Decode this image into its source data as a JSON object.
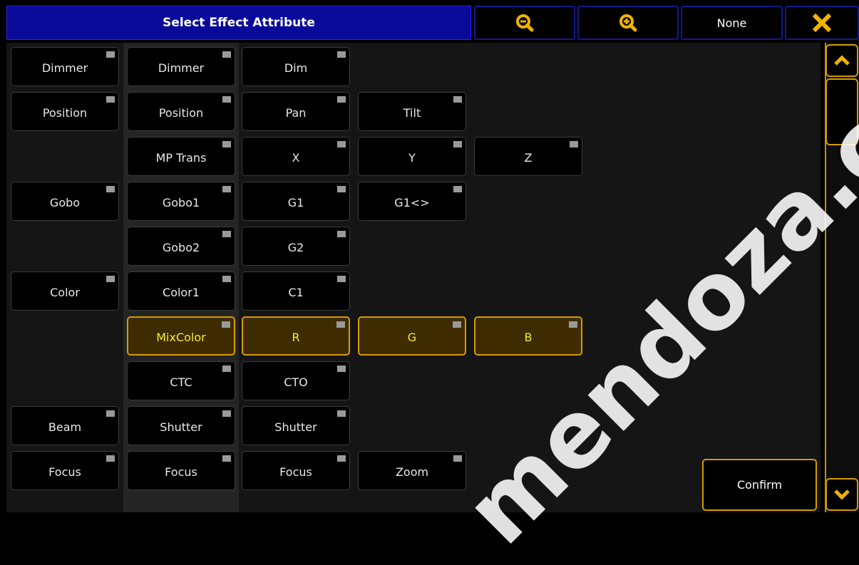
{
  "header": {
    "title": "Select Effect Attribute",
    "none_label": "None"
  },
  "icons": {
    "zoom_out": "zoom-out-icon",
    "zoom_in": "zoom-in-icon",
    "close": "close-icon",
    "scroll_up": "chevron-up-icon",
    "scroll_down": "chevron-down-icon"
  },
  "colors": {
    "accent": "#d49a00",
    "selected_text": "#f2ef2c",
    "title_bg": "#0a0a9a"
  },
  "rows": [
    [
      "Dimmer",
      "Dimmer",
      "Dim",
      "",
      ""
    ],
    [
      "Position",
      "Position",
      "Pan",
      "Tilt",
      ""
    ],
    [
      "",
      "MP Trans",
      "X",
      "Y",
      "Z"
    ],
    [
      "Gobo",
      "Gobo1",
      "G1",
      "G1<>",
      ""
    ],
    [
      "",
      "Gobo2",
      "G2",
      "",
      ""
    ],
    [
      "Color",
      "Color1",
      "C1",
      "",
      ""
    ],
    [
      "",
      "MixColor",
      "R",
      "G",
      "B"
    ],
    [
      "",
      "CTC",
      "CTO",
      "",
      ""
    ],
    [
      "Beam",
      "Shutter",
      "Shutter",
      "",
      ""
    ],
    [
      "Focus",
      "Focus",
      "Focus",
      "Zoom",
      ""
    ]
  ],
  "selected_row": 6,
  "confirm_label": "Confirm",
  "watermark": "mendoza.com.mx"
}
